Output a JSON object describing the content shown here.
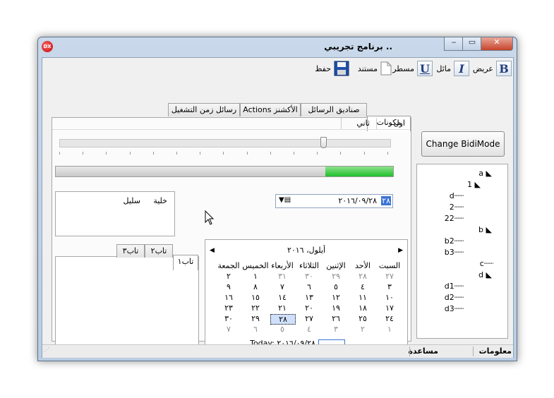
{
  "window": {
    "title": "برنامج تجريبي ..",
    "app_icon": "DX",
    "minimize": "‒",
    "maximize": "▭",
    "close": "✕"
  },
  "toolbar": {
    "bold_label": "عريض",
    "italic_label": "مائل",
    "underline_label": "مسطر",
    "document_label": "مستند",
    "save_label": "حفظ",
    "bold_glyph": "B",
    "italic_glyph": "I",
    "underline_glyph": "U"
  },
  "tabs": [
    {
      "label": "مكونات"
    },
    {
      "label": "صناديق الرسائل"
    },
    {
      "label": "Actions الأكشنز"
    },
    {
      "label": "رسائل زمن التشغيل"
    }
  ],
  "list_header": {
    "col1": "اول",
    "col2": "ثاني"
  },
  "progress": {
    "value": 0.2,
    "color": "#1fbf2a"
  },
  "listbox": {
    "item1": "خلية",
    "item2": "سليل"
  },
  "date_field": {
    "value": "٢٠١٦/٠٩/٢٨",
    "day_highlight": "٢٨"
  },
  "calendar": {
    "month_title": "أيلول، ٢٠١٦",
    "weekdays": [
      "السبت",
      "الأحد",
      "الإثنين",
      "الثلاثاء",
      "الأربعاء",
      "الخميس",
      "الجمعة"
    ],
    "weeks": [
      [
        "٢٧",
        "٢٨",
        "٢٩",
        "٣٠",
        "٣١",
        "١",
        "٢"
      ],
      [
        "٣",
        "٤",
        "٥",
        "٦",
        "٧",
        "٨",
        "٩"
      ],
      [
        "١٠",
        "١١",
        "١٢",
        "١٣",
        "١٤",
        "١٥",
        "١٦"
      ],
      [
        "١٧",
        "١٨",
        "١٩",
        "٢٠",
        "٢١",
        "٢٢",
        "٢٣"
      ],
      [
        "٢٤",
        "٢٥",
        "٢٦",
        "٢٧",
        "٢٨",
        "٢٩",
        "٣٠"
      ],
      [
        "١",
        "٢",
        "٣",
        "٤",
        "٥",
        "٦",
        "٧"
      ]
    ],
    "today_label": "Today: ٢٠١٦/٠٩/٢٨"
  },
  "inner_tabs": [
    "تاب١",
    "تاب٢",
    "تاب٣"
  ],
  "change_bidi_button": "Change BidiMode",
  "tree": [
    {
      "label": "a"
    },
    {
      "label": "1"
    },
    {
      "label": "d"
    },
    {
      "label": "2"
    },
    {
      "label": "22"
    },
    {
      "label": "b"
    },
    {
      "label": "b2"
    },
    {
      "label": "b3"
    },
    {
      "label": "c"
    },
    {
      "label": "d"
    },
    {
      "label": "d1"
    },
    {
      "label": "d2"
    },
    {
      "label": "d3"
    }
  ],
  "statusbar": {
    "info": "معلومات",
    "help": "مساعدة"
  }
}
